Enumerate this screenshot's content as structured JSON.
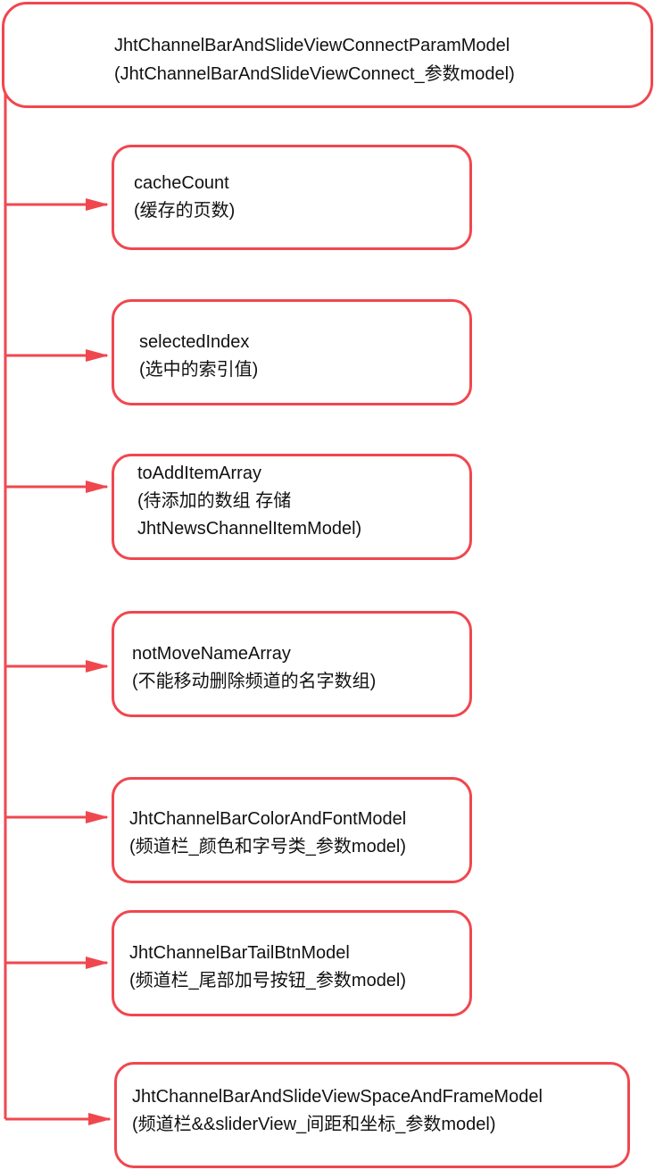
{
  "colors": {
    "stroke": "#f0474f",
    "text": "#111111",
    "background": "#ffffff"
  },
  "root": {
    "name": "JhtChannelBarAndSlideViewConnectParamModel",
    "desc": "(JhtChannelBarAndSlideViewConnect_参数model)"
  },
  "nodes": [
    {
      "name": "cacheCount",
      "desc": "(缓存的页数)"
    },
    {
      "name": "selectedIndex",
      "desc": "(选中的索引值)"
    },
    {
      "name": "toAddItemArray",
      "desc": "(待添加的数组 存储",
      "desc2": "JhtNewsChannelItemModel)"
    },
    {
      "name": "notMoveNameArray",
      "desc": "(不能移动删除频道的名字数组)"
    },
    {
      "name": "JhtChannelBarColorAndFontModel",
      "desc": "(频道栏_颜色和字号类_参数model)"
    },
    {
      "name": "JhtChannelBarTailBtnModel",
      "desc": "(频道栏_尾部加号按钮_参数model)"
    },
    {
      "name": "JhtChannelBarAndSlideViewSpaceAndFrameModel",
      "desc": "(频道栏&&sliderView_间距和坐标_参数model)"
    }
  ]
}
